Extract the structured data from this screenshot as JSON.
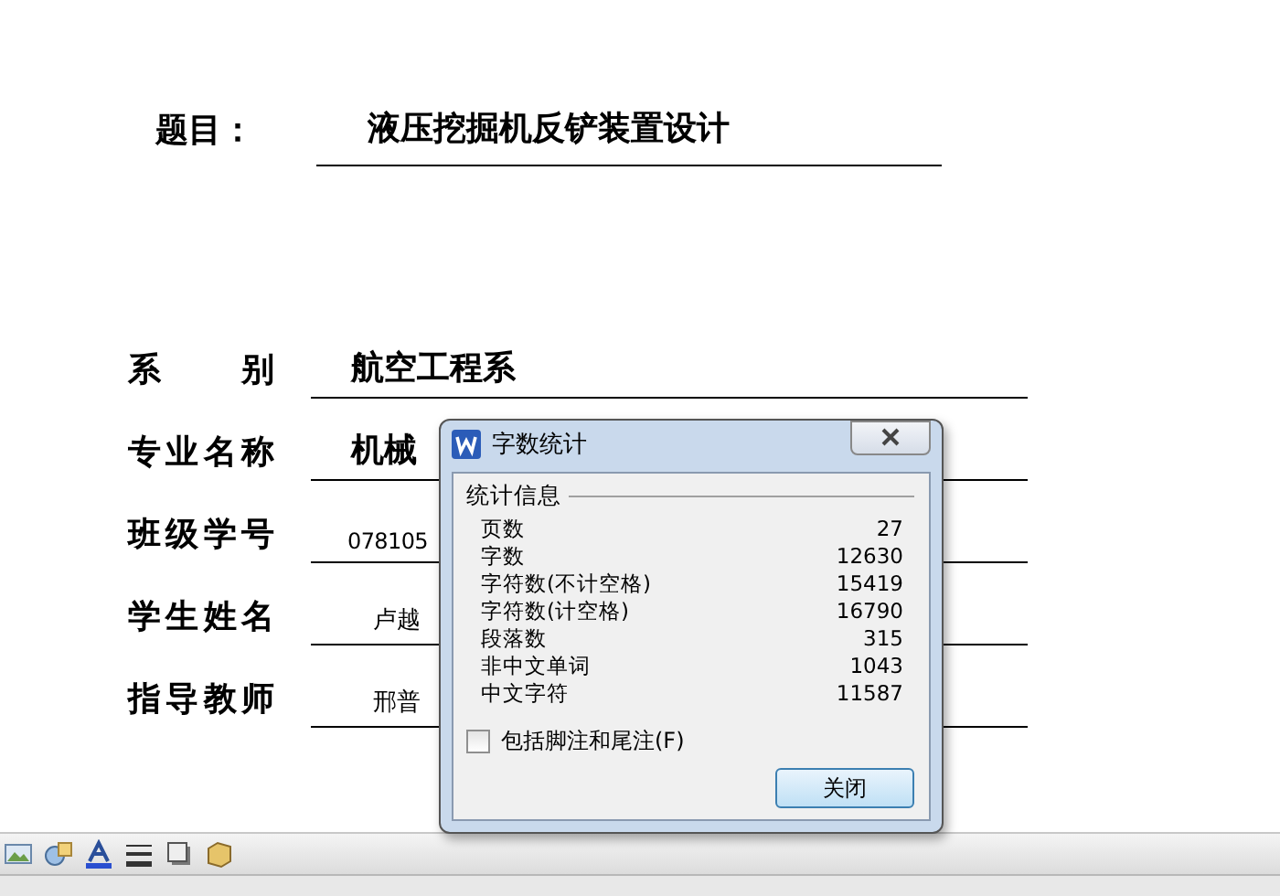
{
  "document": {
    "title_label": "题目：",
    "title_value": "液压挖掘机反铲装置设计",
    "fields": [
      {
        "label": "系别",
        "value": "航空工程系",
        "kind": "bold"
      },
      {
        "label": "专业名称",
        "value": "机械",
        "kind": "bold"
      },
      {
        "label": "班级学号",
        "value": "078105",
        "kind": "plain"
      },
      {
        "label": "学生姓名",
        "value": "卢越",
        "kind": "script"
      },
      {
        "label": "指导教师",
        "value": "邢普",
        "kind": "script"
      }
    ]
  },
  "dialog": {
    "title": "字数统计",
    "group": "统计信息",
    "stats": [
      {
        "label": "页数",
        "value": "27"
      },
      {
        "label": "字数",
        "value": "12630"
      },
      {
        "label": "字符数(不计空格)",
        "value": "15419"
      },
      {
        "label": "字符数(计空格)",
        "value": "16790"
      },
      {
        "label": "段落数",
        "value": "315"
      },
      {
        "label": "非中文单词",
        "value": "1043"
      },
      {
        "label": "中文字符",
        "value": "11587"
      }
    ],
    "checkbox": {
      "label": "包括脚注和尾注(F)",
      "checked": false
    },
    "button": "关闭"
  }
}
